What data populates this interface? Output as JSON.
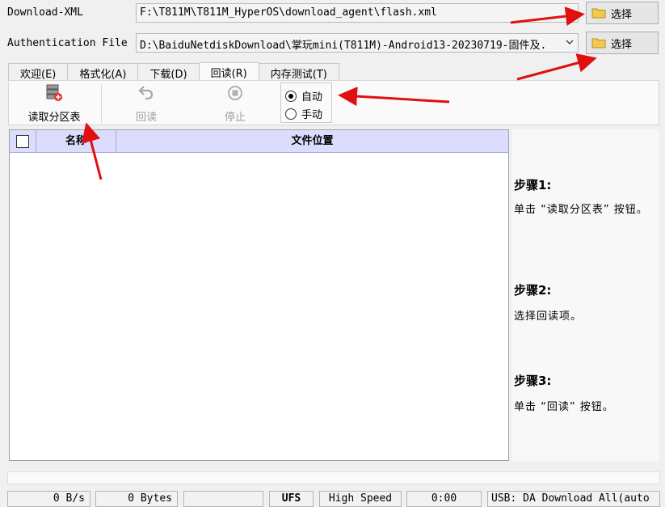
{
  "rows": {
    "download_xml": {
      "label": "Download-XML",
      "value": "F:\\T811M\\T811M_HyperOS\\download_agent\\flash.xml",
      "button": "选择"
    },
    "auth_file": {
      "label": "Authentication File",
      "value": "D:\\BaiduNetdiskDownload\\掌玩mini(T811M)-Android13-20230719-固件及.",
      "button": "选择"
    }
  },
  "tabs": [
    {
      "label": "欢迎(E)"
    },
    {
      "label": "格式化(A)"
    },
    {
      "label": "下载(D)"
    },
    {
      "label": "回读(R)",
      "active": true
    },
    {
      "label": "内存测试(T)"
    }
  ],
  "toolbar": {
    "read_partition": "读取分区表",
    "readback": "回读",
    "stop": "停止",
    "mode_auto": "自动",
    "mode_manual": "手动",
    "selected_mode": "auto"
  },
  "table": {
    "columns": [
      "名称",
      "文件位置"
    ],
    "rows": []
  },
  "help": {
    "step1_title": "步骤1:",
    "step1_text": "单击 “读取分区表” 按钮。",
    "step2_title": "步骤2:",
    "step2_text": "选择回读项。",
    "step3_title": "步骤3:",
    "step3_text": "单击 “回读” 按钮。"
  },
  "status": {
    "speed": "0 B/s",
    "bytes": "0 Bytes",
    "blank": "",
    "storage": "UFS",
    "usb_speed": "High Speed",
    "time": "0:00",
    "usb_mode": "USB: DA Download All(auto"
  },
  "colors": {
    "header_bg": "#dcdcff",
    "annotation_arrow": "#e01010",
    "folder_icon": "#f2c94c"
  }
}
